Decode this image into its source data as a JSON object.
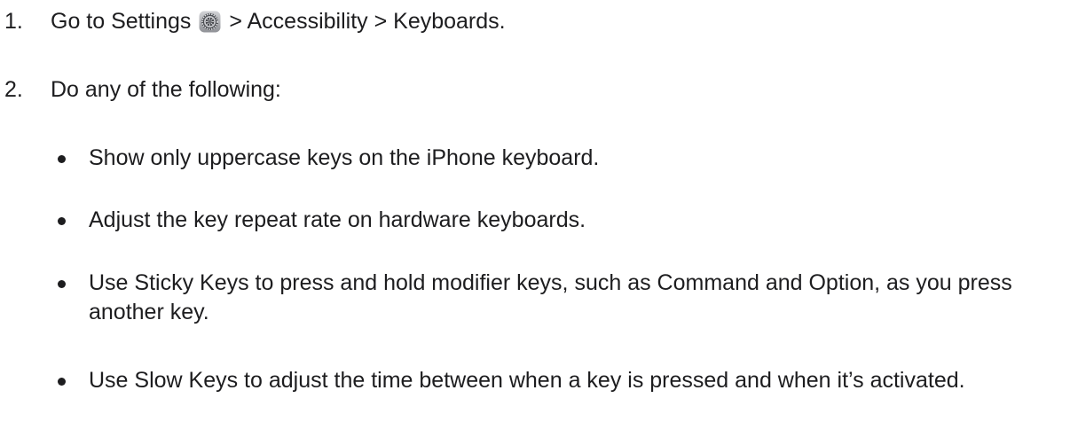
{
  "steps": [
    {
      "number": "1.",
      "prefix": "Go to Settings",
      "icon": "settings-gear-icon",
      "suffix": "> Accessibility > Keyboards."
    },
    {
      "number": "2.",
      "text": "Do any of the following:"
    }
  ],
  "bullets": [
    "Show only uppercase keys on the iPhone keyboard.",
    "Adjust the key repeat rate on hardware keyboards.",
    "Use Sticky Keys to press and hold modifier keys, such as Command and Option, as you press another key.",
    "Use Slow Keys to adjust the time between when a key is pressed and when it’s activated."
  ]
}
